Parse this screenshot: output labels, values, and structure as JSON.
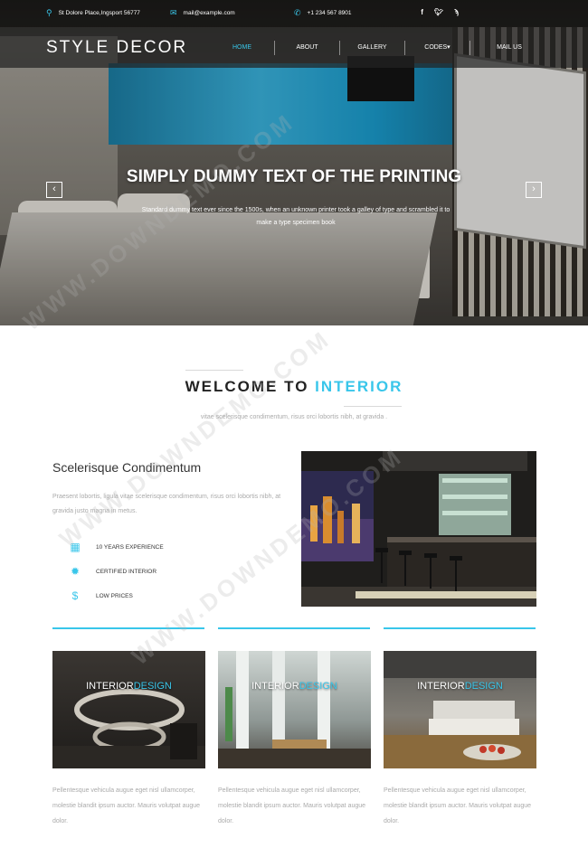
{
  "topbar": {
    "address": "St Dolore Place,Ingsport 56777",
    "email": "mail@example.com",
    "phone": "+1 234 567 8901",
    "social": [
      "f",
      "t",
      "rss"
    ]
  },
  "brand": {
    "logo": "STYLE DECOR"
  },
  "nav": {
    "items": [
      "HOME",
      "ABOUT",
      "GALLERY",
      "CODES▾",
      "MAIL US"
    ]
  },
  "hero": {
    "title": "SIMPLY DUMMY TEXT OF THE PRINTING",
    "subtitle": "Standard dummy text ever since the 1500s, when an unknown printer took a galley of type and scrambled it to make a type specimen book",
    "prev": "‹",
    "next": "›"
  },
  "welcome": {
    "title_part1": "WELCOME TO ",
    "title_part2": "INTERIOR",
    "subtitle": "vitae scelerisque condimentum, risus orci lobortis nibh, at gravida ."
  },
  "about": {
    "heading": "Scelerisque Condimentum",
    "text": "Praesent lobortis, ligula vitae scelerisque condimentum, risus orci lobortis nibh, at gravida justo magna in metus.",
    "features": [
      {
        "icon": "calendar-icon",
        "label": "10 YEARS EXPERIENCE"
      },
      {
        "icon": "badge-icon",
        "label": "CERTIFIED INTERIOR"
      },
      {
        "icon": "dollar-icon",
        "label": "LOW PRICES"
      }
    ]
  },
  "cards": [
    {
      "label_a": "INTERIOR",
      "label_b": "DESIGN",
      "text": "Pellentesque vehicula augue eget nisl ullamcorper, molestie blandit ipsum auctor. Mauris volutpat augue dolor."
    },
    {
      "label_a": "INTERIOR",
      "label_b": "DESIGN",
      "text": "Pellentesque vehicula augue eget nisl ullamcorper, molestie blandit ipsum auctor. Mauris volutpat augue dolor."
    },
    {
      "label_a": "INTERIOR",
      "label_b": "DESIGN",
      "text": "Pellentesque vehicula augue eget nisl ullamcorper, molestie blandit ipsum auctor. Mauris volutpat augue dolor."
    }
  ],
  "watermark": "WWW.DOWNDEMO.COM",
  "colors": {
    "accent": "#39c6ea"
  }
}
